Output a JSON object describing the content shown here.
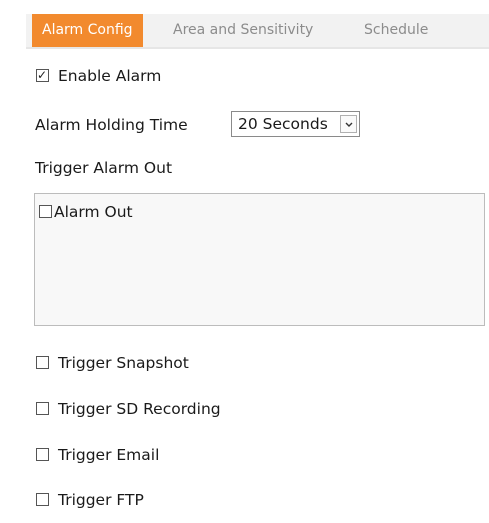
{
  "tabs": [
    {
      "label": "Alarm Config",
      "active": true
    },
    {
      "label": "Area and Sensitivity",
      "active": false
    },
    {
      "label": "Schedule",
      "active": false
    }
  ],
  "enable_alarm": {
    "label": "Enable Alarm",
    "checked": true
  },
  "holding_time": {
    "label": "Alarm Holding Time",
    "value": "20 Seconds"
  },
  "trigger_alarm_out": {
    "label": "Trigger Alarm Out",
    "items": [
      {
        "label": "Alarm Out",
        "checked": false
      }
    ]
  },
  "triggers": [
    {
      "label": "Trigger Snapshot",
      "checked": false
    },
    {
      "label": "Trigger SD Recording",
      "checked": false
    },
    {
      "label": "Trigger Email",
      "checked": false
    },
    {
      "label": "Trigger FTP",
      "checked": false
    }
  ],
  "colors": {
    "active_tab": "#f28a2e",
    "tab_bar": "#f2f2f2",
    "inactive_tab_text": "#8c8c8c"
  },
  "icons": {
    "dropdown": "chevron-down-icon",
    "check": "checkmark-icon"
  }
}
